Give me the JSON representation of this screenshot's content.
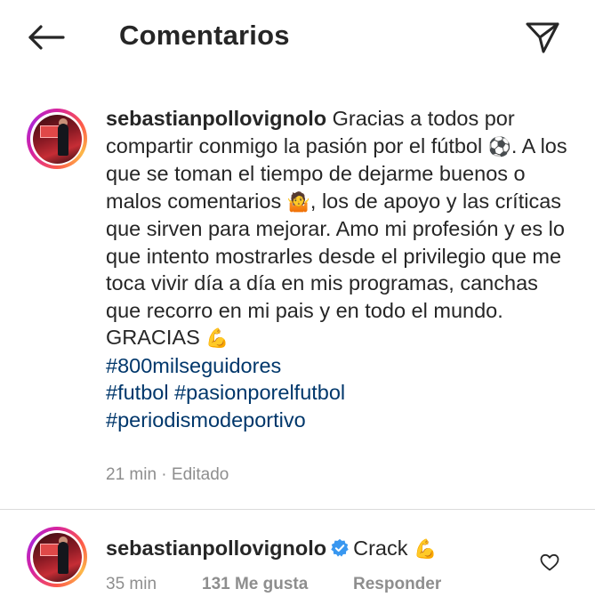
{
  "header": {
    "title": "Comentarios",
    "back_icon": "arrow-left-icon",
    "send_icon": "paper-plane-icon"
  },
  "caption": {
    "username": "sebastianpollovignolo",
    "line1_text": " Gracias a todos por compartir conmigo la pasión por el fútbol ",
    "emoji_soccer": "⚽",
    "line2_text": ". A los que se toman el tiempo de dejarme buenos o malos comentarios ",
    "emoji_shrug": "🤷",
    "line3_text": ", los de apoyo y las críticas que sirven para mejorar. Amo mi profesión  y es lo que intento mostrarles desde el privilegio que me toca vivir día a día en mis programas, canchas que recorro en mi pais y en todo el mundo. GRACIAS ",
    "emoji_muscle": "💪",
    "hashtags": [
      "#800milseguidores",
      "#futbol",
      "#pasionporelfutbol",
      "#periodismodeportivo"
    ],
    "time": "21 min",
    "edited": "Editado",
    "separator": " · "
  },
  "reply": {
    "username": "sebastianpollovignolo",
    "text": "Crack",
    "emoji_muscle": "💪",
    "time": "35 min",
    "likes": "131 Me gusta",
    "reply_label": "Responder"
  },
  "colors": {
    "hashtag": "#00376b",
    "meta": "#8e8e8e",
    "verified": "#3897f0"
  }
}
